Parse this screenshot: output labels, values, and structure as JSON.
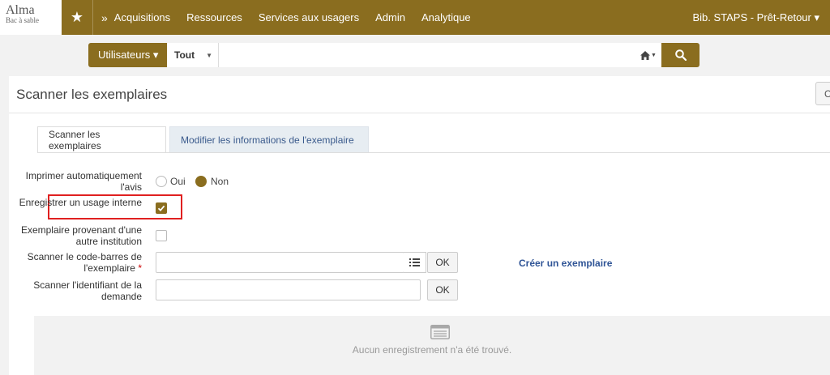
{
  "logo": {
    "name": "Alma",
    "subtitle": "Bac à sable"
  },
  "nav": {
    "items": [
      "Acquisitions",
      "Ressources",
      "Services aux usagers",
      "Admin",
      "Analytique"
    ],
    "library": "Bib. STAPS - Prêt-Retour ▾"
  },
  "search": {
    "type_label": "Utilisateurs ▾",
    "scope_label": "Tout",
    "value": ""
  },
  "page": {
    "title": "Scanner les exemplaires",
    "corner_button": "C"
  },
  "tabs": [
    {
      "label": "Scanner les exemplaires",
      "active": true
    },
    {
      "label": "Modifier les informations de l'exemplaire",
      "active": false
    }
  ],
  "form": {
    "print_label": "Imprimer automatiquement l'avis",
    "print_options": [
      "Oui",
      "Non"
    ],
    "print_selected": "Non",
    "internal_use_label": "Enregistrer un usage interne",
    "internal_use_checked": true,
    "other_institution_label": "Exemplaire provenant d'une autre institution",
    "other_institution_checked": false,
    "barcode_label": "Scanner le code-barres de l'exemplaire",
    "barcode_required_mark": "*",
    "barcode_value": "",
    "request_label": "Scanner l'identifiant de la demande",
    "request_value": "",
    "ok_label": "OK",
    "create_link": "Créer un exemplaire"
  },
  "empty_state": {
    "message": "Aucun enregistrement n'a été trouvé."
  },
  "colors": {
    "brand": "#8a6d1f",
    "link": "#2f5496",
    "highlight": "#e02020"
  }
}
